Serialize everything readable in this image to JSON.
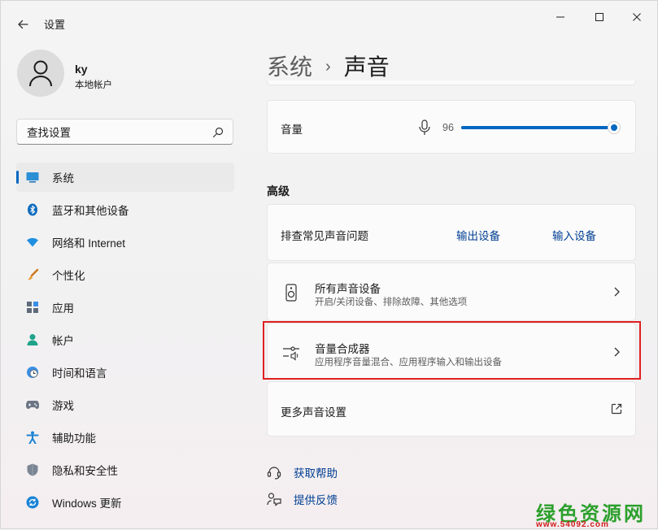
{
  "window": {
    "title": "设置",
    "controls": [
      "minimize-icon",
      "maximize-icon",
      "close-icon"
    ]
  },
  "user": {
    "name": "ky",
    "account": "本地帐户"
  },
  "search": {
    "placeholder": "查找设置"
  },
  "sidebar": {
    "items": [
      {
        "label": "系统",
        "icon": "system-icon",
        "active": true
      },
      {
        "label": "蓝牙和其他设备",
        "icon": "bluetooth-icon"
      },
      {
        "label": "网络和 Internet",
        "icon": "wifi-icon"
      },
      {
        "label": "个性化",
        "icon": "brush-icon"
      },
      {
        "label": "应用",
        "icon": "apps-icon"
      },
      {
        "label": "帐户",
        "icon": "account-icon"
      },
      {
        "label": "时间和语言",
        "icon": "clock-globe-icon"
      },
      {
        "label": "游戏",
        "icon": "gamepad-icon"
      },
      {
        "label": "辅助功能",
        "icon": "accessibility-icon"
      },
      {
        "label": "隐私和安全性",
        "icon": "shield-icon"
      },
      {
        "label": "Windows 更新",
        "icon": "update-icon"
      }
    ]
  },
  "breadcrumb": {
    "parent": "系统",
    "separator": "›",
    "current": "声音"
  },
  "volume": {
    "label": "音量",
    "value": "96",
    "level": 0.96
  },
  "advanced": {
    "title": "高级",
    "troubleshoot": {
      "label": "排查常见声音问题",
      "output_link": "输出设备",
      "input_link": "输入设备"
    },
    "all_devices": {
      "title": "所有声音设备",
      "subtitle": "开启/关闭设备、排除故障、其他选项"
    },
    "mixer": {
      "title": "音量合成器",
      "subtitle": "应用程序音量混合、应用程序输入和输出设备"
    },
    "more": {
      "label": "更多声音设置"
    }
  },
  "help": {
    "get_help": "获取帮助",
    "feedback": "提供反馈"
  },
  "watermark": {
    "name": "绿色资源网",
    "url": "www.54092.com"
  },
  "colors": {
    "accent": "#0067c0",
    "link": "#003e92",
    "highlight_box": "#e02020",
    "watermark_green": "#2ca02c",
    "watermark_red": "#d11a1a"
  }
}
